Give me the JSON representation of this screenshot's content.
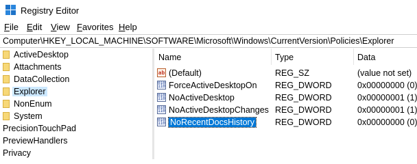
{
  "window": {
    "title": "Registry Editor",
    "icon": "registry-editor-icon"
  },
  "menu": [
    "File",
    "Edit",
    "View",
    "Favorites",
    "Help"
  ],
  "address": "Computer\\HKEY_LOCAL_MACHINE\\SOFTWARE\\Microsoft\\Windows\\CurrentVersion\\Policies\\Explorer",
  "tree": {
    "items": [
      {
        "label": "ActiveDesktop",
        "folder": true
      },
      {
        "label": "Attachments",
        "folder": true
      },
      {
        "label": "DataCollection",
        "folder": true
      },
      {
        "label": "Explorer",
        "folder": true,
        "selected": true
      },
      {
        "label": "NonEnum",
        "folder": true
      },
      {
        "label": "System",
        "folder": true
      },
      {
        "label": "PrecisionTouchPad",
        "folder": false
      },
      {
        "label": "PreviewHandlers",
        "folder": false
      },
      {
        "label": "Privacy",
        "folder": false
      }
    ]
  },
  "list": {
    "headers": {
      "name": "Name",
      "type": "Type",
      "data": "Data"
    },
    "rows": [
      {
        "name": "(Default)",
        "type": "REG_SZ",
        "data": "(value not set)",
        "icon": "string-value-icon"
      },
      {
        "name": "ForceActiveDesktopOn",
        "type": "REG_DWORD",
        "data": "0x00000000 (0)",
        "icon": "binary-value-icon"
      },
      {
        "name": "NoActiveDesktop",
        "type": "REG_DWORD",
        "data": "0x00000001 (1)",
        "icon": "binary-value-icon"
      },
      {
        "name": "NoActiveDesktopChanges",
        "type": "REG_DWORD",
        "data": "0x00000001 (1)",
        "icon": "binary-value-icon"
      },
      {
        "name": "NoRecentDocsHistory",
        "type": "REG_DWORD",
        "data": "0x00000000 (0)",
        "icon": "binary-value-icon",
        "selected": true
      }
    ]
  }
}
